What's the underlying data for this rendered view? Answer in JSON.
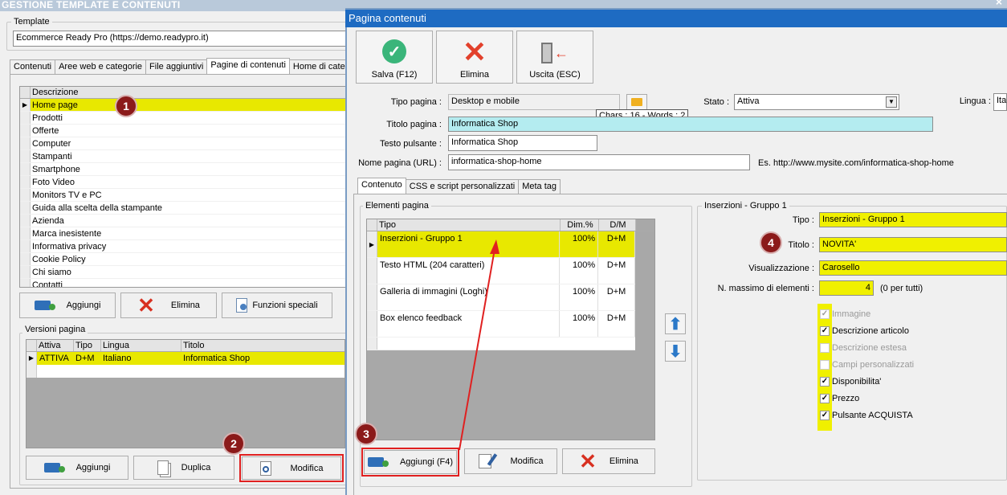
{
  "main": {
    "title": "GESTIONE TEMPLATE E CONTENUTI",
    "template_label": "Template",
    "template_value": "Ecommerce Ready Pro (https://demo.readypro.it)",
    "tabs": [
      "Contenuti",
      "Aree web e categorie",
      "File aggiuntivi",
      "Pagine di contenuti",
      "Home di catego"
    ],
    "pages_header": "Descrizione",
    "pages": [
      "Home page",
      "Prodotti",
      "Offerte",
      "Computer",
      "Stampanti",
      "Smartphone",
      "Foto Video",
      "Monitors TV e PC",
      "Guida alla scelta della stampante",
      "Azienda",
      "Marca inesistente",
      "Informativa privacy",
      "Cookie Policy",
      "Chi siamo",
      "Contatti"
    ],
    "btn_add": "Aggiungi",
    "btn_delete": "Elimina",
    "btn_special": "Funzioni speciali",
    "versions_label": "Versioni pagina",
    "versions_headers": [
      "Attiva",
      "Tipo",
      "Lingua",
      "Titolo"
    ],
    "versions_row": [
      "ATTIVA",
      "D+M",
      "Italiano",
      "Informatica Shop"
    ],
    "btn_add2": "Aggiungi",
    "btn_duplicate": "Duplica",
    "btn_modify": "Modifica"
  },
  "dialog": {
    "title": "Pagina contenuti",
    "close": "×",
    "save": "Salva (F12)",
    "delete": "Elimina",
    "exit": "Uscita (ESC)",
    "tipo_pagina_label": "Tipo pagina :",
    "tipo_pagina_value": "Desktop e mobile",
    "stato_label": "Stato :",
    "stato_value": "Attiva",
    "lingua_label": "Lingua :",
    "lingua_value": "Ita",
    "tooltip": "Chars : 16 - Words : 2",
    "titolo_label": "Titolo pagina :",
    "titolo_value": "Informatica Shop",
    "pulsante_label": "Testo pulsante :",
    "pulsante_value": "Informatica Shop",
    "url_label": "Nome pagina (URL) :",
    "url_value": "informatica-shop-home",
    "url_example": "Es. http://www.mysite.com/informatica-shop-home",
    "tabs": [
      "Contenuto",
      "CSS e script personalizzati",
      "Meta tag"
    ],
    "elements_label": "Elementi pagina",
    "el_headers": [
      "Tipo",
      "Dim.%",
      "D/M"
    ],
    "elements": [
      {
        "tipo": "Inserzioni - Gruppo 1",
        "dim": "100%",
        "dm": "D+M"
      },
      {
        "tipo": "Testo HTML (204 caratteri)",
        "dim": "100%",
        "dm": "D+M"
      },
      {
        "tipo": "Galleria di immagini (Loghi)",
        "dim": "100%",
        "dm": "D+M"
      },
      {
        "tipo": "Box elenco feedback",
        "dim": "100%",
        "dm": "D+M"
      }
    ],
    "btn_add": "Aggiungi (F4)",
    "btn_modify": "Modifica",
    "btn_delete": "Elimina",
    "group_label": "Inserzioni - Gruppo 1",
    "g_tipo_label": "Tipo :",
    "g_tipo_value": "Inserzioni - Gruppo 1",
    "g_titolo_label": "Titolo :",
    "g_titolo_value": "NOVITA'",
    "g_vis_label": "Visualizzazione :",
    "g_vis_value": "Carosello",
    "g_max_label": "N. massimo di elementi :",
    "g_max_value": "4",
    "g_max_note": "(0 per tutti)",
    "checks": [
      {
        "label": "Immagine",
        "checked": true,
        "enabled": false
      },
      {
        "label": "Descrizione articolo",
        "checked": true,
        "enabled": true
      },
      {
        "label": "Descrizione estesa",
        "checked": false,
        "enabled": false
      },
      {
        "label": "Campi personalizzati",
        "checked": false,
        "enabled": false
      },
      {
        "label": "Disponibilita'",
        "checked": true,
        "enabled": true
      },
      {
        "label": "Prezzo",
        "checked": true,
        "enabled": true
      },
      {
        "label": "Pulsante ACQUISTA",
        "checked": true,
        "enabled": true
      }
    ]
  },
  "badges": [
    "1",
    "2",
    "3",
    "4"
  ],
  "colors": {
    "highlight": "#e8e800",
    "badge": "#8b1a1a",
    "annotation": "#e02020",
    "title_field": "#b4ecf0"
  }
}
